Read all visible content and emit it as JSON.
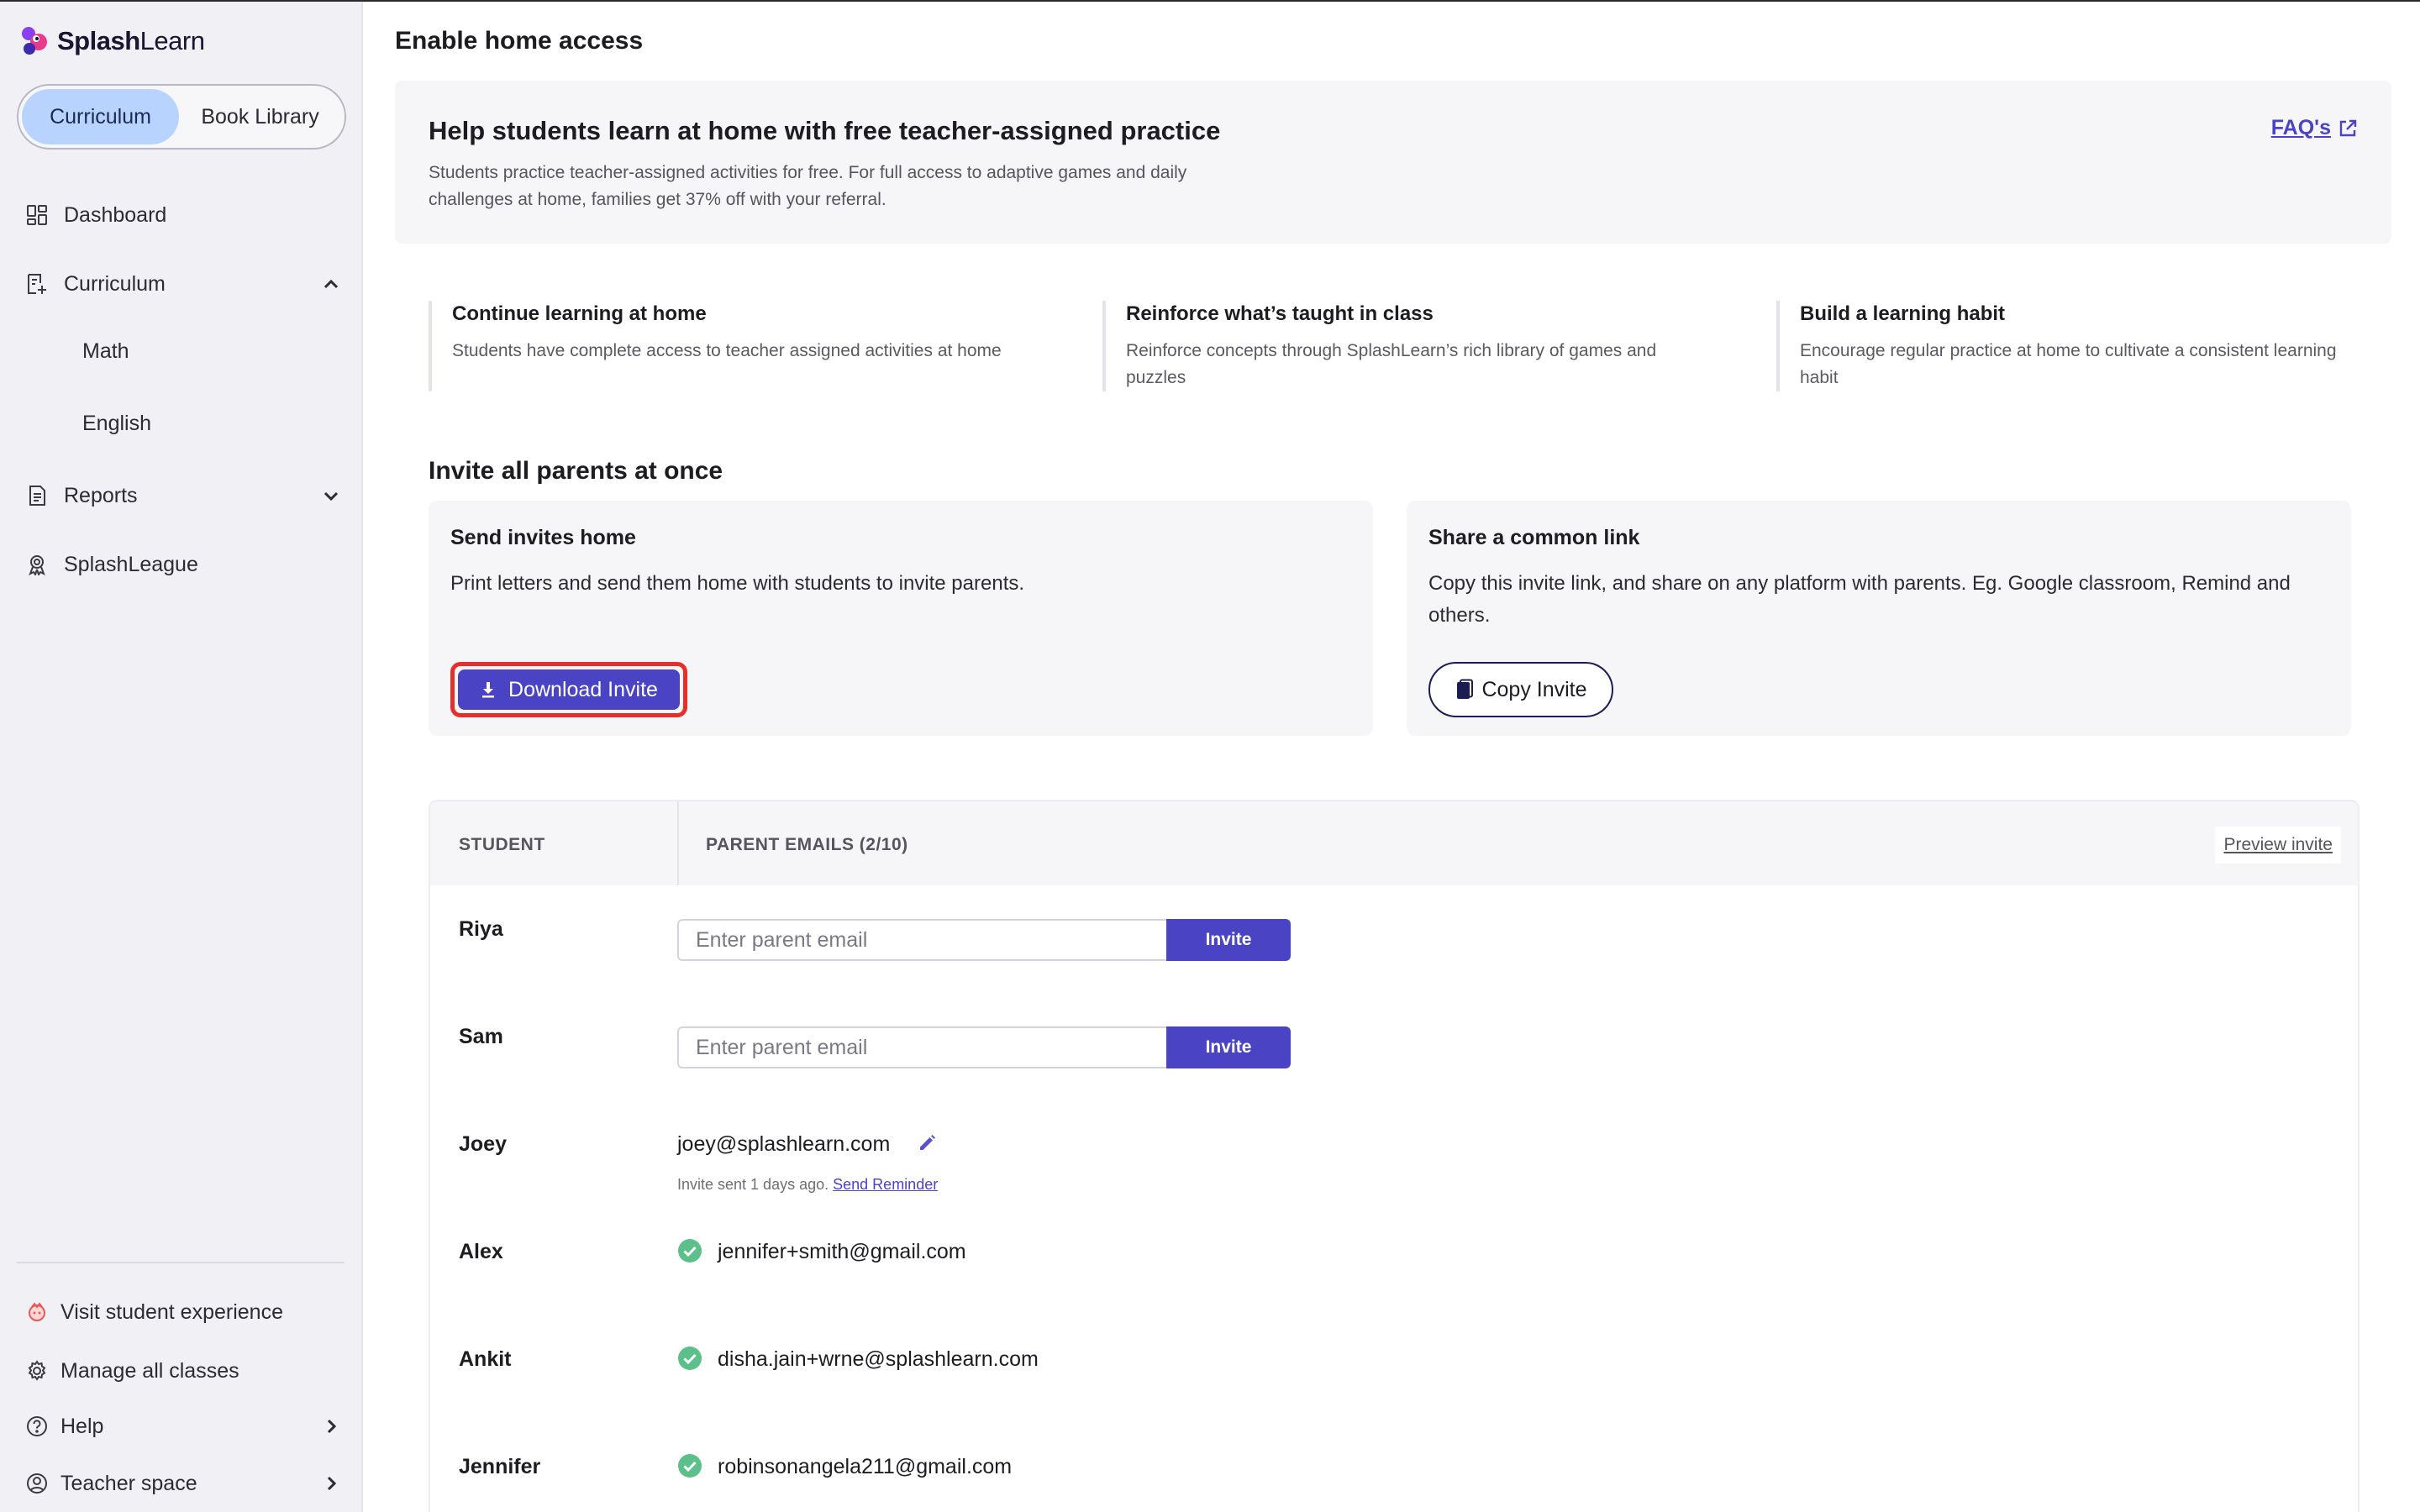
{
  "brand": {
    "name_bold": "Splash",
    "name_light": "Learn"
  },
  "sidebar": {
    "tabs": [
      {
        "label": "Curriculum",
        "active": true
      },
      {
        "label": "Book Library",
        "active": false
      }
    ],
    "items": {
      "dashboard": "Dashboard",
      "curriculum": "Curriculum",
      "math": "Math",
      "english": "English",
      "reports": "Reports",
      "splashleague": "SplashLeague"
    },
    "footer": {
      "visit_student": "Visit student experience",
      "manage_classes": "Manage all classes",
      "help": "Help",
      "teacher_space": "Teacher space"
    }
  },
  "page": {
    "title": "Enable home access"
  },
  "hero": {
    "title": "Help students learn at home with free teacher-assigned practice",
    "description": "Students practice teacher-assigned activities for free. For full access to adaptive games and daily challenges at home, families get 37% off with your referral.",
    "faq_label": "FAQ's"
  },
  "features": [
    {
      "title": "Continue learning at home",
      "description": "Students have complete access to teacher assigned activities at home"
    },
    {
      "title": "Reinforce what’s taught in class",
      "description": "Reinforce concepts through SplashLearn’s rich library of games and puzzles"
    },
    {
      "title": "Build a learning habit",
      "description": "Encourage regular practice at home to cultivate a consistent learning habit"
    }
  ],
  "invite_section": {
    "title": "Invite all parents at once",
    "send_home": {
      "title": "Send invites home",
      "description": "Print letters and send them home with students to invite parents.",
      "button": "Download Invite"
    },
    "share_link": {
      "title": "Share a common link",
      "description": "Copy this invite link, and share on any platform with parents. Eg. Google classroom, Remind and others.",
      "button": "Copy Invite"
    }
  },
  "table": {
    "col_student": "STUDENT",
    "col_emails": "PARENT EMAILS (2/10)",
    "preview_label": "Preview invite",
    "email_placeholder": "Enter parent email",
    "invite_label": "Invite",
    "rows": [
      {
        "name": "Riya"
      },
      {
        "name": "Sam"
      },
      {
        "name": "Joey",
        "email": "joey@splashlearn.com",
        "note": "Invite sent 1 days ago.",
        "reminder": "Send Reminder"
      },
      {
        "name": "Alex",
        "email": "jennifer+smith@gmail.com"
      },
      {
        "name": "Ankit",
        "email": "disha.jain+wrne@splashlearn.com"
      },
      {
        "name": "Jennifer",
        "email": "robinsonangela211@gmail.com"
      }
    ]
  },
  "colors": {
    "accent": "#4a44c4",
    "highlight": "#e62e2a",
    "success": "#5cc08a",
    "tab_active": "#b9d3ff"
  }
}
